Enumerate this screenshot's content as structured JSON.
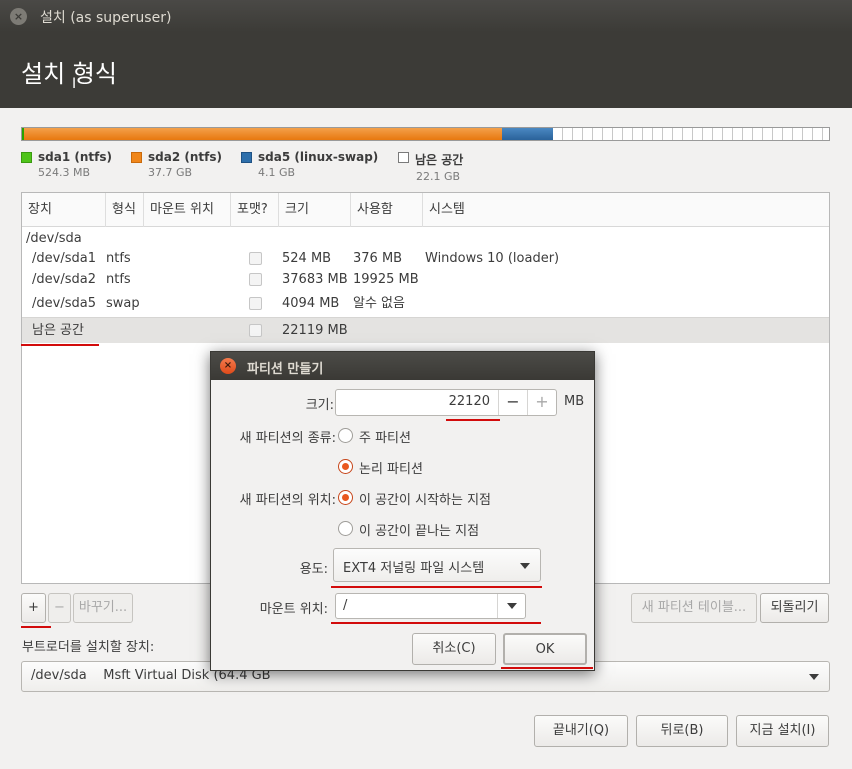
{
  "window": {
    "title": "설치 (as superuser)",
    "heading": "설치 형식"
  },
  "partition_bar": {
    "segments": [
      {
        "name": "sda1",
        "color": "#27a300",
        "fraction": 0.002
      },
      {
        "name": "sda2",
        "color": "#f0861a",
        "fraction": 0.594
      },
      {
        "name": "sda5",
        "color": "#2e6fab",
        "fraction": 0.063
      },
      {
        "name": "free",
        "color": "#ffffff",
        "fraction": 0.341
      }
    ]
  },
  "legend": [
    {
      "name": "sda1 (ntfs)",
      "size": "524.3 MB",
      "color": "#4fc41a"
    },
    {
      "name": "sda2 (ntfs)",
      "size": "37.7 GB",
      "color": "#f0861a"
    },
    {
      "name": "sda5 (linux-swap)",
      "size": "4.1 GB",
      "color": "#2e6fab"
    },
    {
      "name": "남은 공간",
      "size": "22.1 GB",
      "color": "#ffffff"
    }
  ],
  "table": {
    "columns": [
      "장치",
      "형식",
      "마운트 위치",
      "포맷?",
      "크기",
      "사용함",
      "시스템"
    ],
    "group": "/dev/sda",
    "rows": [
      {
        "device": "/dev/sda1",
        "type": "ntfs",
        "size": "524 MB",
        "used": "376 MB",
        "system": "Windows 10 (loader)"
      },
      {
        "device": "/dev/sda2",
        "type": "ntfs",
        "size": "37683 MB",
        "used": "19925 MB",
        "system": ""
      },
      {
        "device": "/dev/sda5",
        "type": "swap",
        "size": "4094 MB",
        "used": "알수 없음",
        "system": ""
      },
      {
        "device": "남은 공간",
        "type": "",
        "size": "22119 MB",
        "used": "",
        "system": ""
      }
    ]
  },
  "toolbar": {
    "add": "+",
    "remove": "−",
    "change": "바꾸기...",
    "new_table": "새 파티션 테이블...",
    "revert": "되돌리기"
  },
  "bootloader": {
    "label": "부트로더를 설치할 장치:",
    "value": "/dev/sda    Msft Virtual Disk (64.4 GB"
  },
  "footer": {
    "quit": "끝내기(Q)",
    "back": "뒤로(B)",
    "install": "지금 설치(I)"
  },
  "dialog": {
    "title": "파티션 만들기",
    "size_label": "크기:",
    "size_value": "22120",
    "size_unit": "MB",
    "minus": "−",
    "plus": "+",
    "type_label": "새 파티션의 종류:",
    "type_primary": "주 파티션",
    "type_logical": "논리 파티션",
    "location_label": "새 파티션의 위치:",
    "location_start": "이 공간이 시작하는 지점",
    "location_end": "이 공간이 끝나는 지점",
    "use_label": "용도:",
    "use_value": "EXT4 저널링 파일 시스템",
    "mount_label": "마운트 위치:",
    "mount_value": "/",
    "cancel": "취소(C)",
    "ok": "OK"
  },
  "colors": {
    "annotation_red": "#d20b0b",
    "header_bg": "#3c3b37",
    "accent_orange": "#e9581f"
  }
}
